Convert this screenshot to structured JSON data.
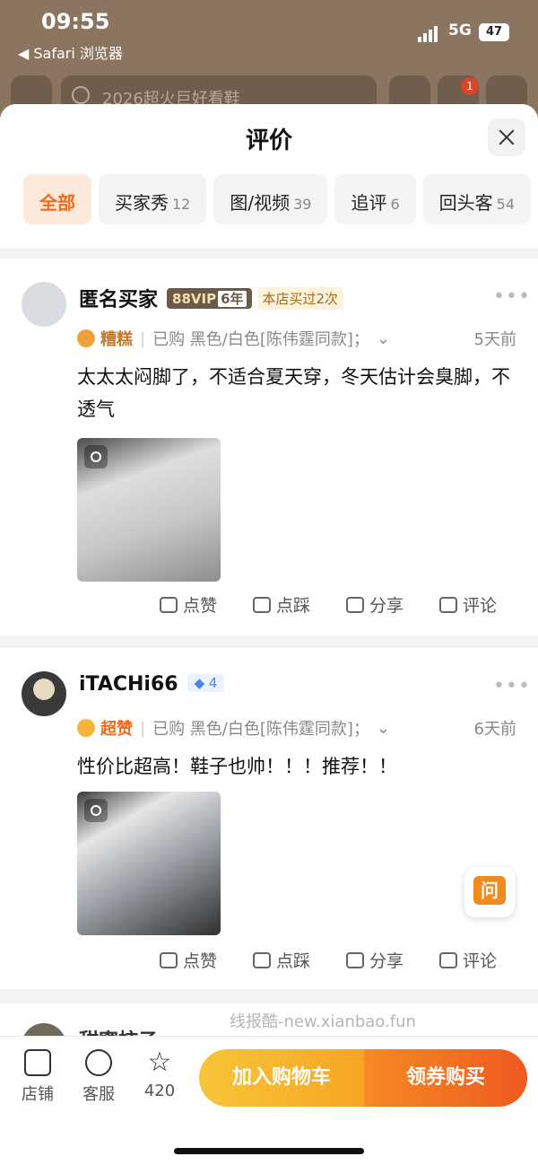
{
  "status": {
    "time": "09:55",
    "back_app": "◀ Safari 浏览器",
    "network": "5G",
    "battery": "47"
  },
  "nav": {
    "search_placeholder": "2026超火巨好看鞋",
    "cart_badge": "1"
  },
  "sheet": {
    "title": "评价"
  },
  "filters": [
    {
      "label": "全部",
      "count": ""
    },
    {
      "label": "买家秀",
      "count": "12"
    },
    {
      "label": "图/视频",
      "count": "39"
    },
    {
      "label": "追评",
      "count": "6"
    },
    {
      "label": "回头客",
      "count": "54"
    }
  ],
  "reviews": [
    {
      "user": "匿名买家",
      "vip": "88VIP",
      "vip_years": "6年",
      "store_tag": "本店买过2次",
      "mood": "糟糕",
      "purchase": "已购 黑色/白色[陈伟霆同款]；",
      "time_ago": "5天前",
      "text": "太太太闷脚了，不适合夏天穿，冬天估计会臭脚，不透气"
    },
    {
      "user": "iTACHi66",
      "level": "4",
      "mood": "超赞",
      "purchase": "已购 黑色/白色[陈伟霆同款]；",
      "time_ago": "6天前",
      "text": "性价比超高！鞋子也帅！！！推荐！！"
    }
  ],
  "actions": {
    "like": "点赞",
    "dislike": "点踩",
    "share": "分享",
    "comment": "评论"
  },
  "float_ask": "问",
  "peek_user": "甜蜜柿子",
  "watermark": "线报酷-new.xianbao.fun",
  "bottom": {
    "store": "店铺",
    "service": "客服",
    "favorites": "420",
    "add_cart": "加入购物车",
    "buy": "领券购买"
  },
  "colors": {
    "accent": "#f26a1b",
    "cart_button": "#f7b52e",
    "buy_button": "#ef5a1f"
  }
}
